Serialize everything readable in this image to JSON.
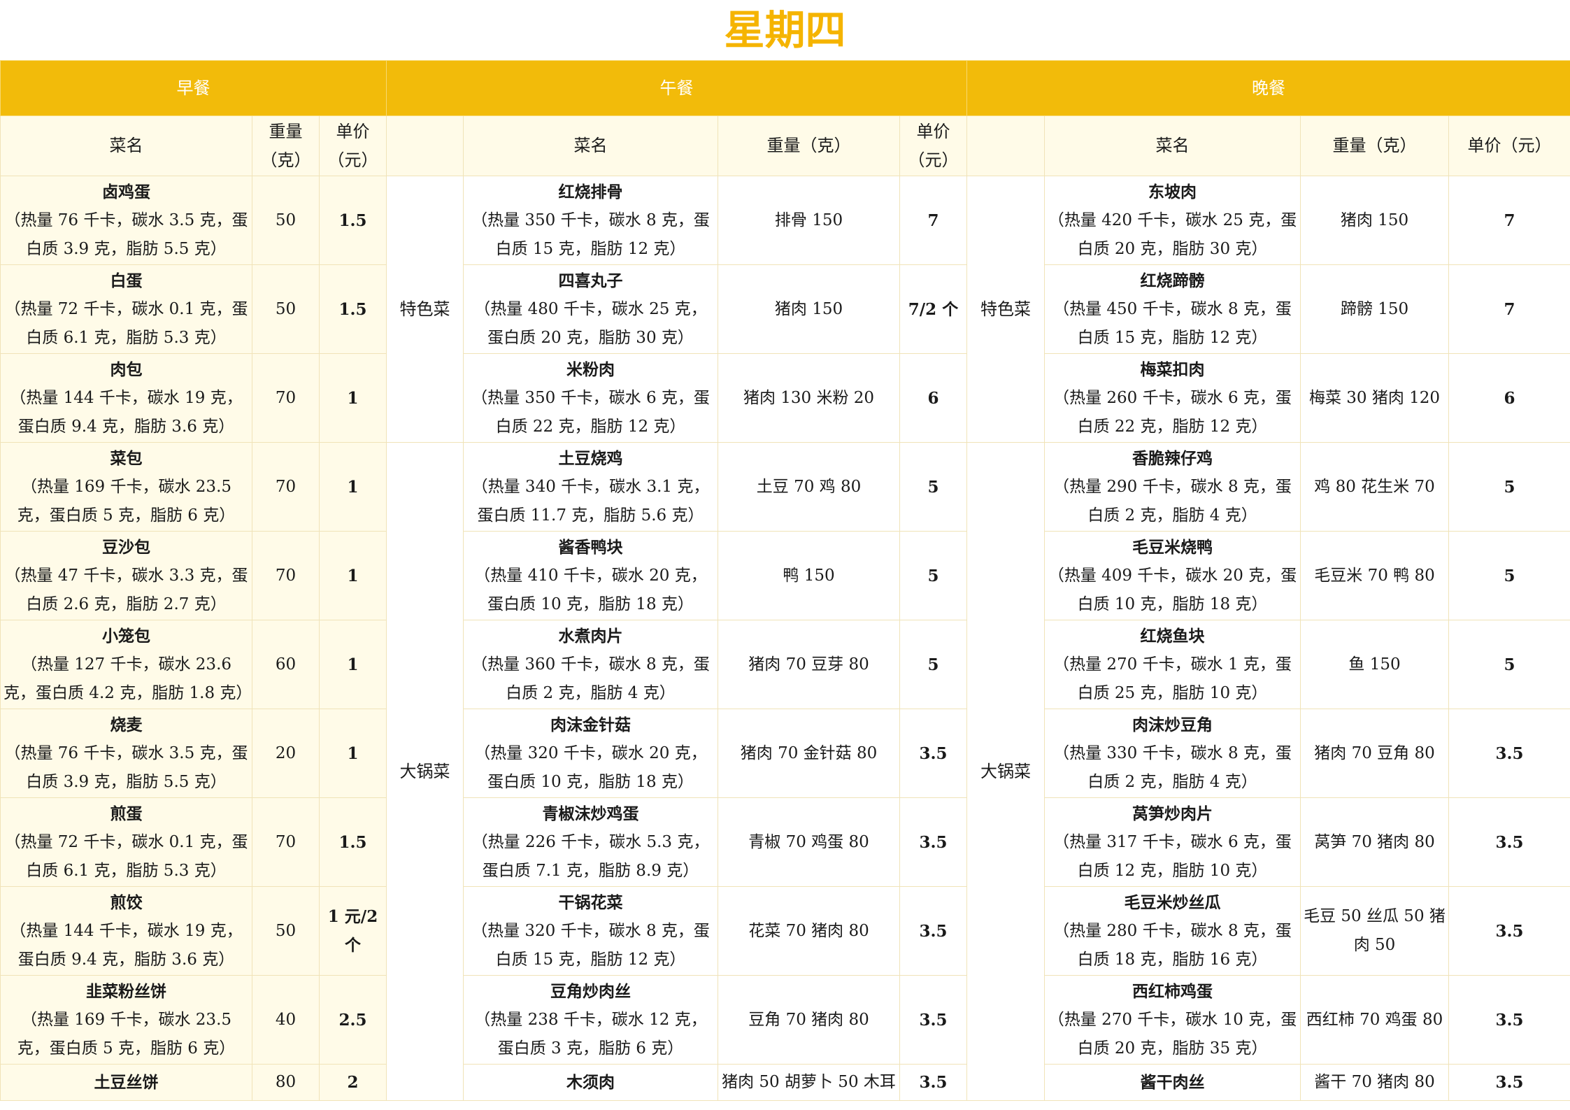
{
  "title": "星期四",
  "meals": {
    "breakfast": "早餐",
    "lunch": "午餐",
    "dinner": "晚餐"
  },
  "headers": {
    "breakfast": {
      "name": "菜名",
      "weight": "重量（克）",
      "price": "单价（元）"
    },
    "lunch": {
      "category": "",
      "name": "菜名",
      "weight": "重量（克）",
      "price": "单价（元）"
    },
    "dinner": {
      "category": "",
      "name": "菜名",
      "weight": "重量（克）",
      "price": "单价（元）"
    }
  },
  "categories": {
    "special": "特色菜",
    "big_pot": "大锅菜"
  },
  "breakfast": [
    {
      "name": "卤鸡蛋",
      "nutrition": "（热量 76 千卡，碳水 3.5 克，蛋白质 3.9 克，脂肪 5.5 克）",
      "weight": "50",
      "price": "1.5"
    },
    {
      "name": "白蛋",
      "nutrition": "（热量 72 千卡，碳水 0.1 克，蛋白质 6.1 克，脂肪 5.3 克）",
      "weight": "50",
      "price": "1.5"
    },
    {
      "name": "肉包",
      "nutrition": "（热量 144 千卡，碳水 19 克，蛋白质 9.4 克，脂肪 3.6 克）",
      "weight": "70",
      "price": "1"
    },
    {
      "name": "菜包",
      "nutrition": "（热量 169 千卡，碳水 23.5 克，蛋白质 5 克，脂肪 6 克）",
      "weight": "70",
      "price": "1"
    },
    {
      "name": "豆沙包",
      "nutrition": "（热量 47 千卡，碳水 3.3 克，蛋白质 2.6 克，脂肪 2.7 克）",
      "weight": "70",
      "price": "1"
    },
    {
      "name": "小笼包",
      "nutrition": "（热量 127 千卡，碳水 23.6 克，蛋白质 4.2 克，脂肪 1.8 克）",
      "weight": "60",
      "price": "1"
    },
    {
      "name": "烧麦",
      "nutrition": "（热量 76 千卡，碳水 3.5 克，蛋白质 3.9 克，脂肪 5.5 克）",
      "weight": "20",
      "price": "1"
    },
    {
      "name": "煎蛋",
      "nutrition": "（热量 72 千卡，碳水 0.1 克，蛋白质 6.1 克，脂肪 5.3 克）",
      "weight": "70",
      "price": "1.5"
    },
    {
      "name": "煎饺",
      "nutrition": "（热量 144 千卡，碳水 19 克，蛋白质 9.4 克，脂肪 3.6 克）",
      "weight": "50",
      "price": "1 元/2 个"
    },
    {
      "name": "韭菜粉丝饼",
      "nutrition": "（热量 169 千卡，碳水 23.5 克，蛋白质 5 克，脂肪 6 克）",
      "weight": "40",
      "price": "2.5"
    },
    {
      "name": "土豆丝饼",
      "nutrition": "",
      "weight": "80",
      "price": "2"
    }
  ],
  "lunch": [
    {
      "name": "红烧排骨",
      "nutrition": "（热量 350 千卡，碳水 8 克，蛋白质 15 克，脂肪 12 克）",
      "weight": "排骨 150",
      "price": "7"
    },
    {
      "name": "四喜丸子",
      "nutrition": "（热量 480 千卡，碳水 25 克，蛋白质 20 克，脂肪 30 克）",
      "weight": "猪肉 150",
      "price": "7/2 个"
    },
    {
      "name": "米粉肉",
      "nutrition": "（热量 350 千卡，碳水 6 克，蛋白质 22 克，脂肪 12 克）",
      "weight": "猪肉 130 米粉 20",
      "price": "6"
    },
    {
      "name": "土豆烧鸡",
      "nutrition": "（热量 340 千卡，碳水 3.1 克，蛋白质 11.7 克，脂肪 5.6 克）",
      "weight": "土豆 70 鸡 80",
      "price": "5"
    },
    {
      "name": "酱香鸭块",
      "nutrition": "（热量 410 千卡，碳水 20 克，蛋白质 10 克，脂肪 18 克）",
      "weight": "鸭 150",
      "price": "5"
    },
    {
      "name": "水煮肉片",
      "nutrition": "（热量 360 千卡，碳水 8 克，蛋白质 2 克，脂肪 4 克）",
      "weight": "猪肉 70 豆芽 80",
      "price": "5"
    },
    {
      "name": "肉沫金针菇",
      "nutrition": "（热量 320 千卡，碳水 20 克，蛋白质 10 克，脂肪 18 克）",
      "weight": "猪肉 70 金针菇 80",
      "price": "3.5"
    },
    {
      "name": "青椒沫炒鸡蛋",
      "nutrition": "（热量 226 千卡，碳水 5.3 克，蛋白质 7.1 克，脂肪 8.9 克）",
      "weight": "青椒 70 鸡蛋 80",
      "price": "3.5"
    },
    {
      "name": "干锅花菜",
      "nutrition": "（热量 320 千卡，碳水 8 克，蛋白质 15 克，脂肪 12 克）",
      "weight": "花菜 70 猪肉 80",
      "price": "3.5"
    },
    {
      "name": "豆角炒肉丝",
      "nutrition": "（热量 238 千卡，碳水 12 克，蛋白质 3 克，脂肪 6 克）",
      "weight": "豆角 70 猪肉 80",
      "price": "3.5"
    },
    {
      "name": "木须肉",
      "nutrition": "",
      "weight": "猪肉 50 胡萝卜 50 木耳",
      "price": "3.5"
    }
  ],
  "dinner": [
    {
      "name": "东坡肉",
      "nutrition": "（热量 420 千卡，碳水 25 克，蛋白质 20 克，脂肪 30 克）",
      "weight": "猪肉 150",
      "price": "7"
    },
    {
      "name": "红烧蹄髈",
      "nutrition": "（热量 450 千卡，碳水 8 克，蛋白质 15 克，脂肪 12 克）",
      "weight": "蹄髈 150",
      "price": "7"
    },
    {
      "name": "梅菜扣肉",
      "nutrition": "（热量 260 千卡，碳水 6 克，蛋白质 22 克，脂肪 12 克）",
      "weight": "梅菜 30 猪肉 120",
      "price": "6"
    },
    {
      "name": "香脆辣仔鸡",
      "nutrition": "（热量 290 千卡，碳水 8 克，蛋白质 2 克，脂肪 4 克）",
      "weight": "鸡 80 花生米 70",
      "price": "5"
    },
    {
      "name": "毛豆米烧鸭",
      "nutrition": "（热量 409 千卡，碳水 20 克，蛋白质 10 克，脂肪 18 克）",
      "weight": "毛豆米 70 鸭 80",
      "price": "5"
    },
    {
      "name": "红烧鱼块",
      "nutrition": "（热量 270 千卡，碳水 1 克，蛋白质 25 克，脂肪 10 克）",
      "weight": "鱼 150",
      "price": "5"
    },
    {
      "name": "肉沫炒豆角",
      "nutrition": "（热量 330 千卡，碳水 8 克，蛋白质 2 克，脂肪 4 克）",
      "weight": "猪肉 70 豆角 80",
      "price": "3.5"
    },
    {
      "name": "莴笋炒肉片",
      "nutrition": "（热量 317 千卡，碳水 6 克，蛋白质 12 克，脂肪 10 克）",
      "weight": "莴笋 70 猪肉 80",
      "price": "3.5"
    },
    {
      "name": "毛豆米炒丝瓜",
      "nutrition": "（热量 280 千卡，碳水 8 克，蛋白质 18 克，脂肪 16 克）",
      "weight": "毛豆 50 丝瓜 50 猪肉 50",
      "price": "3.5"
    },
    {
      "name": "西红柿鸡蛋",
      "nutrition": "（热量 270 千卡，碳水 10 克，蛋白质 20 克，脂肪 35 克）",
      "weight": "西红柿 70 鸡蛋 80",
      "price": "3.5"
    },
    {
      "name": "酱干肉丝",
      "nutrition": "",
      "weight": "酱干 70 猪肉 80",
      "price": "3.5"
    }
  ]
}
